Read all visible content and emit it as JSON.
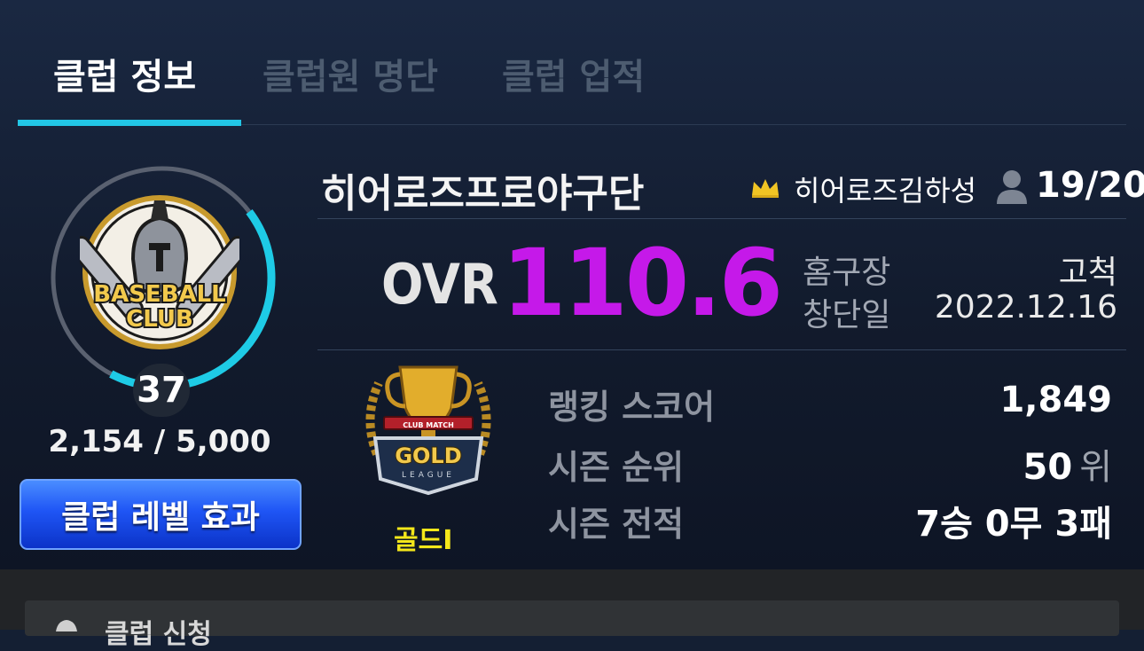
{
  "tabs": [
    {
      "label": "클럽 정보",
      "active": true
    },
    {
      "label": "클럽원 명단",
      "active": false
    },
    {
      "label": "클럽 업적",
      "active": false
    }
  ],
  "club": {
    "level": "37",
    "exp": "2,154 / 5,000",
    "exp_progress": 0.4308,
    "logo_text_line1": "BASEBALL",
    "logo_text_line2": "CLUB",
    "level_effect_button": "클럽 레벨 효과",
    "name": "히어로즈프로야구단",
    "leader": "히어로즈김하성",
    "members": "19/20",
    "ovr_label": "OVR",
    "ovr_value": "110.6",
    "home_label": "홈구장",
    "home_value": "고척",
    "founded_label": "창단일",
    "founded_value": "2022.12.16"
  },
  "tier": {
    "name": "골드I",
    "badge_top_text": "CLUB MATCH",
    "badge_text": "GOLD",
    "badge_sub_text": "LEAGUE"
  },
  "stats": {
    "ranking_score_label": "랭킹 스코어",
    "ranking_score_value": "1,849",
    "season_rank_label": "시즌 순위",
    "season_rank_value": "50",
    "season_rank_unit": "위",
    "season_record_label": "시즌 전적",
    "season_record_value": "7승 0무 3패"
  },
  "bottom": {
    "label": "클럽 신청"
  },
  "colors": {
    "accent_cyan": "#22c6e6",
    "ovr_purple": "#c519e9",
    "tier_yellow": "#f4e71a",
    "button_blue": "#1f55f5"
  },
  "icons": [
    "crown-icon",
    "member-icon",
    "club-logo",
    "gold-tier-badge",
    "bell-icon"
  ]
}
